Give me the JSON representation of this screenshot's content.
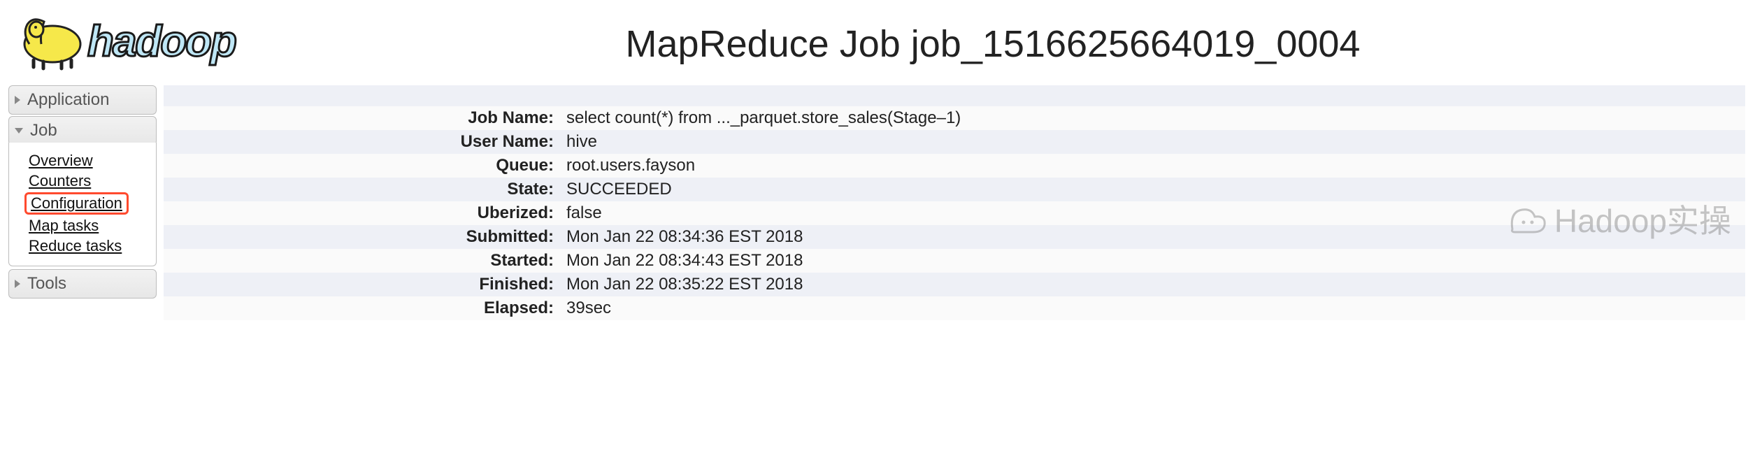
{
  "header": {
    "title": "MapReduce Job job_1516625664019_0004"
  },
  "sidebar": {
    "application_label": "Application",
    "job_label": "Job",
    "tools_label": "Tools",
    "job_links": {
      "overview": "Overview",
      "counters": "Counters",
      "configuration": "Configuration",
      "map_tasks": "Map tasks",
      "reduce_tasks": "Reduce tasks"
    }
  },
  "summary": {
    "labels": {
      "job_name": "Job Name:",
      "user_name": "User Name:",
      "queue": "Queue:",
      "state": "State:",
      "uberized": "Uberized:",
      "submitted": "Submitted:",
      "started": "Started:",
      "finished": "Finished:",
      "elapsed": "Elapsed:"
    },
    "values": {
      "job_name": "select count(*) from ..._parquet.store_sales(Stage–1)",
      "user_name": "hive",
      "queue": "root.users.fayson",
      "state": "SUCCEEDED",
      "uberized": "false",
      "submitted": "Mon Jan 22 08:34:36 EST 2018",
      "started": "Mon Jan 22 08:34:43 EST 2018",
      "finished": "Mon Jan 22 08:35:22 EST 2018",
      "elapsed": "39sec"
    }
  },
  "watermark": "Hadoop实操"
}
